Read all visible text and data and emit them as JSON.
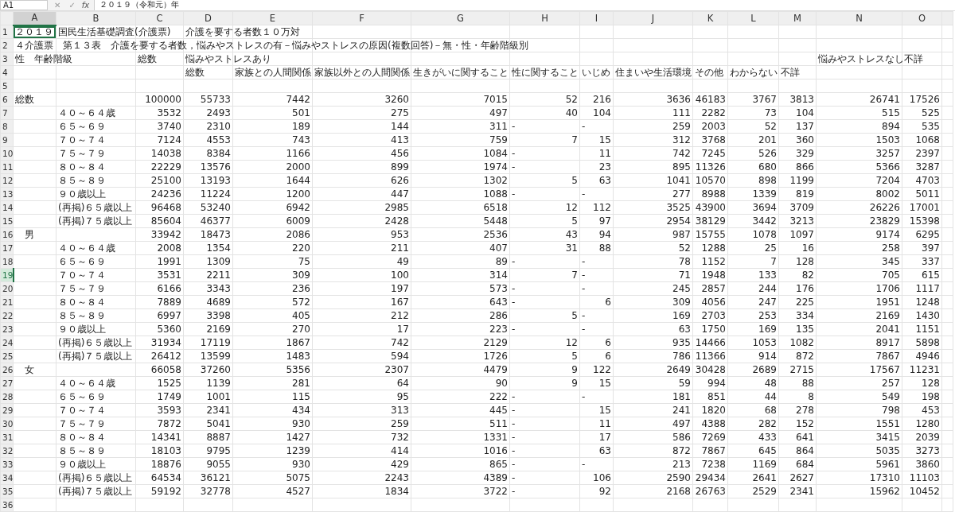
{
  "formula_bar": {
    "name_box": "A1",
    "buttons": [
      "✕",
      "✓"
    ],
    "function_label": "fx",
    "formula": "２０１９（令和元）年"
  },
  "columns": [
    {
      "label": "A",
      "selected": true
    },
    {
      "label": "B",
      "selected": false
    },
    {
      "label": "C",
      "selected": false
    },
    {
      "label": "D",
      "selected": false
    },
    {
      "label": "E",
      "selected": false
    },
    {
      "label": "F",
      "selected": false
    },
    {
      "label": "G",
      "selected": false
    },
    {
      "label": "H",
      "selected": false
    },
    {
      "label": "I",
      "selected": false
    },
    {
      "label": "J",
      "selected": false
    },
    {
      "label": "K",
      "selected": false
    },
    {
      "label": "L",
      "selected": false
    },
    {
      "label": "M",
      "selected": false
    },
    {
      "label": "N",
      "selected": false
    },
    {
      "label": "O",
      "selected": false
    }
  ],
  "rows": [
    {
      "number": "1",
      "selected": false,
      "kind": "heading",
      "cells": [
        {
          "text": "２０１９",
          "active": true
        },
        {
          "text": "国民生活基礎調査(介護票)",
          "active": false
        },
        null,
        {
          "text": "介護を要する者数１０万対",
          "active": false
        }
      ]
    },
    {
      "number": "2",
      "selected": false,
      "kind": "heading",
      "cells": [
        {
          "text": "４介護票　第１３表　介護を要する者数，悩みやストレスの有－悩みやストレスの原因(複数回答)－無・性・年齢階級別",
          "active": false
        }
      ]
    },
    {
      "number": "3",
      "selected": false,
      "kind": "heading",
      "cells": [
        {
          "text": "性　年齢階級",
          "active": false
        },
        null,
        {
          "text": "総数",
          "active": false
        },
        {
          "text": "悩みやストレスあり",
          "active": false
        },
        null,
        null,
        null,
        null,
        null,
        null,
        null,
        null,
        null,
        {
          "text": "悩みやストレスなし",
          "active": false
        },
        {
          "text": "不詳",
          "active": false
        }
      ]
    },
    {
      "number": "4",
      "selected": false,
      "kind": "heading",
      "cells": [
        null,
        null,
        null,
        {
          "text": "総数",
          "active": false
        },
        {
          "text": "家族との人間関係",
          "active": false
        },
        {
          "text": "家族以外との人間関係",
          "active": false
        },
        {
          "text": "生きがいに関すること",
          "active": false
        },
        {
          "text": "性に関すること",
          "active": false
        },
        {
          "text": "いじめ",
          "active": false
        },
        {
          "text": "住まいや生活環境",
          "active": false
        },
        {
          "text": "その他",
          "active": false
        },
        {
          "text": "わからない",
          "active": false
        },
        {
          "text": "不詳",
          "active": false
        }
      ]
    },
    {
      "number": "5",
      "selected": false,
      "kind": "empty"
    },
    {
      "number": "6",
      "selected": false,
      "kind": "data",
      "a": "総数",
      "indented": false,
      "values": [
        "100000",
        "55733",
        "7442",
        "3260",
        "7015",
        "52",
        "216",
        "3636",
        "46183",
        "3767",
        "3813",
        "26741",
        "17526"
      ]
    },
    {
      "number": "7",
      "selected": false,
      "kind": "data",
      "b": "４０～６４歳",
      "values": [
        "3532",
        "2493",
        "501",
        "275",
        "497",
        "40",
        "104",
        "111",
        "2282",
        "73",
        "104",
        "515",
        "525"
      ]
    },
    {
      "number": "8",
      "selected": false,
      "kind": "data",
      "b": "６５～６９",
      "values": [
        "3740",
        "2310",
        "189",
        "144",
        "311",
        {
          "text": "-",
          "kind": "text"
        },
        {
          "text": "-",
          "kind": "text"
        },
        "259",
        "2003",
        "52",
        "137",
        "894",
        "535"
      ]
    },
    {
      "number": "9",
      "selected": false,
      "kind": "data",
      "b": "７０～７４",
      "values": [
        "7124",
        "4553",
        "743",
        "413",
        "759",
        "7",
        "15",
        "312",
        "3768",
        "201",
        "360",
        "1503",
        "1068"
      ]
    },
    {
      "number": "10",
      "selected": false,
      "kind": "data",
      "b": "７５～７９",
      "values": [
        "14038",
        "8384",
        "1166",
        "456",
        "1084",
        {
          "text": "-",
          "kind": "text"
        },
        "11",
        "742",
        "7245",
        "526",
        "329",
        "3257",
        "2397"
      ]
    },
    {
      "number": "11",
      "selected": false,
      "kind": "data",
      "b": "８０～８４",
      "values": [
        "22229",
        "13576",
        "2000",
        "899",
        "1974",
        {
          "text": "-",
          "kind": "text"
        },
        "23",
        "895",
        "11326",
        "680",
        "866",
        "5366",
        "3287"
      ]
    },
    {
      "number": "12",
      "selected": false,
      "kind": "data",
      "b": "８５～８９",
      "values": [
        "25100",
        "13193",
        "1644",
        "626",
        "1302",
        "5",
        "63",
        "1041",
        "10570",
        "898",
        "1199",
        "7204",
        "4703"
      ]
    },
    {
      "number": "13",
      "selected": false,
      "kind": "data",
      "b": "９０歳以上",
      "values": [
        "24236",
        "11224",
        "1200",
        "447",
        "1088",
        {
          "text": "-",
          "kind": "text"
        },
        {
          "text": "-",
          "kind": "text"
        },
        "277",
        "8988",
        "1339",
        "819",
        "8002",
        "5011"
      ]
    },
    {
      "number": "14",
      "selected": false,
      "kind": "data",
      "b": "(再掲)６５歳以上",
      "values": [
        "96468",
        "53240",
        "6942",
        "2985",
        "6518",
        "12",
        "112",
        "3525",
        "43900",
        "3694",
        "3709",
        "26226",
        "17001"
      ]
    },
    {
      "number": "15",
      "selected": false,
      "kind": "data",
      "b": "(再掲)７５歳以上",
      "values": [
        "85604",
        "46377",
        "6009",
        "2428",
        "5448",
        "5",
        "97",
        "2954",
        "38129",
        "3442",
        "3213",
        "23829",
        "15398"
      ]
    },
    {
      "number": "16",
      "selected": false,
      "kind": "data",
      "a": "男",
      "indented": true,
      "values": [
        "33942",
        "18473",
        "2086",
        "953",
        "2536",
        "43",
        "94",
        "987",
        "15755",
        "1078",
        "1097",
        "9174",
        "6295"
      ]
    },
    {
      "number": "17",
      "selected": false,
      "kind": "data",
      "b": "４０～６４歳",
      "values": [
        "2008",
        "1354",
        "220",
        "211",
        "407",
        "31",
        "88",
        "52",
        "1288",
        "25",
        "16",
        "258",
        "397"
      ]
    },
    {
      "number": "18",
      "selected": false,
      "kind": "data",
      "b": "６５～６９",
      "values": [
        "1991",
        "1309",
        "75",
        "49",
        "89",
        {
          "text": "-",
          "kind": "text"
        },
        {
          "text": "-",
          "kind": "text"
        },
        "78",
        "1152",
        "7",
        "128",
        "345",
        "337"
      ]
    },
    {
      "number": "19",
      "selected": true,
      "kind": "data",
      "b": "７０～７４",
      "values": [
        "3531",
        "2211",
        "309",
        "100",
        "314",
        "7",
        {
          "text": "-",
          "kind": "text"
        },
        "71",
        "1948",
        "133",
        "82",
        "705",
        "615"
      ]
    },
    {
      "number": "20",
      "selected": false,
      "kind": "data",
      "b": "７５～７９",
      "values": [
        "6166",
        "3343",
        "236",
        "197",
        "573",
        {
          "text": "-",
          "kind": "text"
        },
        {
          "text": "-",
          "kind": "text"
        },
        "245",
        "2857",
        "244",
        "176",
        "1706",
        "1117"
      ]
    },
    {
      "number": "21",
      "selected": false,
      "kind": "data",
      "b": "８０～８４",
      "values": [
        "7889",
        "4689",
        "572",
        "167",
        "643",
        {
          "text": "-",
          "kind": "text"
        },
        "6",
        "309",
        "4056",
        "247",
        "225",
        "1951",
        "1248"
      ]
    },
    {
      "number": "22",
      "selected": false,
      "kind": "data",
      "b": "８５～８９",
      "values": [
        "6997",
        "3398",
        "405",
        "212",
        "286",
        "5",
        {
          "text": "-",
          "kind": "text"
        },
        "169",
        "2703",
        "253",
        "334",
        "2169",
        "1430"
      ]
    },
    {
      "number": "23",
      "selected": false,
      "kind": "data",
      "b": "９０歳以上",
      "values": [
        "5360",
        "2169",
        "270",
        "17",
        "223",
        {
          "text": "-",
          "kind": "text"
        },
        {
          "text": "-",
          "kind": "text"
        },
        "63",
        "1750",
        "169",
        "135",
        "2041",
        "1151"
      ]
    },
    {
      "number": "24",
      "selected": false,
      "kind": "data",
      "b": "(再掲)６５歳以上",
      "values": [
        "31934",
        "17119",
        "1867",
        "742",
        "2129",
        "12",
        "6",
        "935",
        "14466",
        "1053",
        "1082",
        "8917",
        "5898"
      ]
    },
    {
      "number": "25",
      "selected": false,
      "kind": "data",
      "b": "(再掲)７５歳以上",
      "values": [
        "26412",
        "13599",
        "1483",
        "594",
        "1726",
        "5",
        "6",
        "786",
        "11366",
        "914",
        "872",
        "7867",
        "4946"
      ]
    },
    {
      "number": "26",
      "selected": false,
      "kind": "data",
      "a": "女",
      "indented": true,
      "values": [
        "66058",
        "37260",
        "5356",
        "2307",
        "4479",
        "9",
        "122",
        "2649",
        "30428",
        "2689",
        "2715",
        "17567",
        "11231"
      ]
    },
    {
      "number": "27",
      "selected": false,
      "kind": "data",
      "b": "４０～６４歳",
      "values": [
        "1525",
        "1139",
        "281",
        "64",
        "90",
        "9",
        "15",
        "59",
        "994",
        "48",
        "88",
        "257",
        "128"
      ]
    },
    {
      "number": "28",
      "selected": false,
      "kind": "data",
      "b": "６５～６９",
      "values": [
        "1749",
        "1001",
        "115",
        "95",
        "222",
        {
          "text": "-",
          "kind": "text"
        },
        {
          "text": "-",
          "kind": "text"
        },
        "181",
        "851",
        "44",
        "8",
        "549",
        "198"
      ]
    },
    {
      "number": "29",
      "selected": false,
      "kind": "data",
      "b": "７０～７４",
      "values": [
        "3593",
        "2341",
        "434",
        "313",
        "445",
        {
          "text": "-",
          "kind": "text"
        },
        "15",
        "241",
        "1820",
        "68",
        "278",
        "798",
        "453"
      ]
    },
    {
      "number": "30",
      "selected": false,
      "kind": "data",
      "b": "７５～７９",
      "values": [
        "7872",
        "5041",
        "930",
        "259",
        "511",
        {
          "text": "-",
          "kind": "text"
        },
        "11",
        "497",
        "4388",
        "282",
        "152",
        "1551",
        "1280"
      ]
    },
    {
      "number": "31",
      "selected": false,
      "kind": "data",
      "b": "８０～８４",
      "values": [
        "14341",
        "8887",
        "1427",
        "732",
        "1331",
        {
          "text": "-",
          "kind": "text"
        },
        "17",
        "586",
        "7269",
        "433",
        "641",
        "3415",
        "2039"
      ]
    },
    {
      "number": "32",
      "selected": false,
      "kind": "data",
      "b": "８５～８９",
      "values": [
        "18103",
        "9795",
        "1239",
        "414",
        "1016",
        {
          "text": "-",
          "kind": "text"
        },
        "63",
        "872",
        "7867",
        "645",
        "864",
        "5035",
        "3273"
      ]
    },
    {
      "number": "33",
      "selected": false,
      "kind": "data",
      "b": "９０歳以上",
      "values": [
        "18876",
        "9055",
        "930",
        "429",
        "865",
        {
          "text": "-",
          "kind": "text"
        },
        {
          "text": "-",
          "kind": "text"
        },
        "213",
        "7238",
        "1169",
        "684",
        "5961",
        "3860"
      ]
    },
    {
      "number": "34",
      "selected": false,
      "kind": "data",
      "b": "(再掲)６５歳以上",
      "values": [
        "64534",
        "36121",
        "5075",
        "2243",
        "4389",
        {
          "text": "-",
          "kind": "text"
        },
        "106",
        "2590",
        "29434",
        "2641",
        "2627",
        "17310",
        "11103"
      ]
    },
    {
      "number": "35",
      "selected": false,
      "kind": "data",
      "b": "(再掲)７５歳以上",
      "values": [
        "59192",
        "32778",
        "4527",
        "1834",
        "3722",
        {
          "text": "-",
          "kind": "text"
        },
        "92",
        "2168",
        "26763",
        "2529",
        "2341",
        "15962",
        "10452"
      ]
    },
    {
      "number": "36",
      "selected": false,
      "kind": "empty"
    }
  ]
}
